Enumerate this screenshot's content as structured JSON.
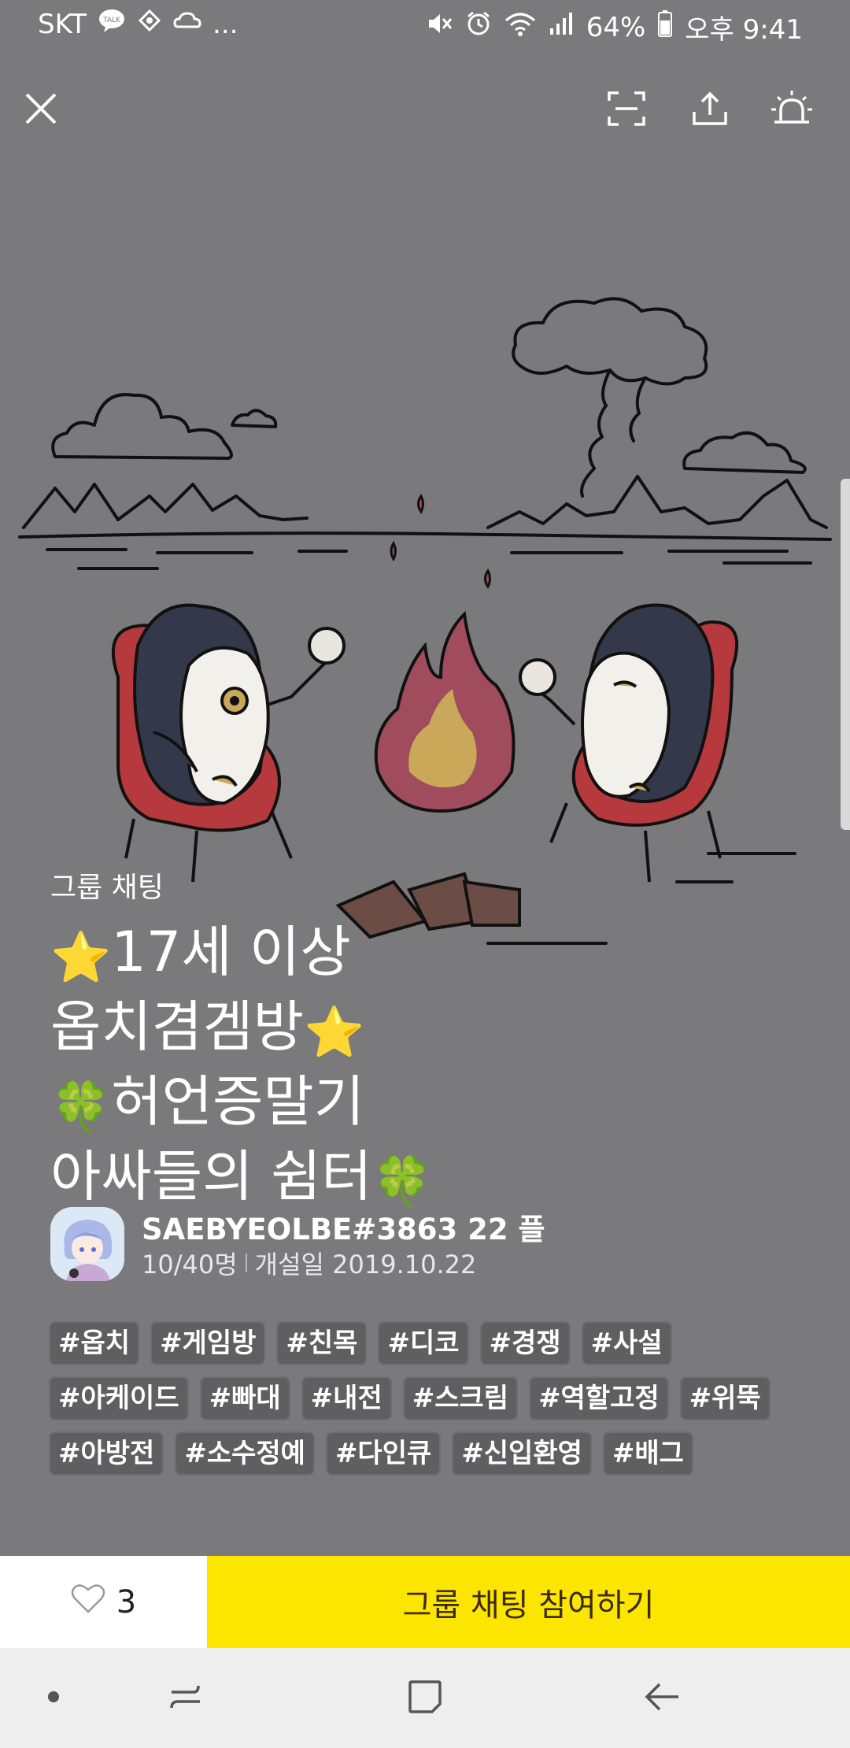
{
  "status_bar": {
    "carrier": "SKT",
    "notif_icons": [
      "talk-icon",
      "app-icon",
      "weather-icon"
    ],
    "more": "...",
    "battery": "64%",
    "time": "오후 9:41"
  },
  "top_bar": {
    "icons": [
      "close-icon",
      "scan-icon",
      "share-icon",
      "report-siren-icon"
    ]
  },
  "room": {
    "category": "그룹 채팅",
    "title_lines": [
      {
        "prefix": "⭐",
        "text": "17세 이상",
        "suffix": ""
      },
      {
        "prefix": "",
        "text": "옵치겸겜방",
        "suffix": "⭐"
      },
      {
        "prefix": "🍀",
        "text": "허언증말기",
        "suffix": ""
      },
      {
        "prefix": "",
        "text": "아싸들의 쉼터",
        "suffix": "🍀"
      }
    ],
    "owner_name": "SAEBYEOLBE#3863 22 플",
    "member_count": "10/40명",
    "opened_label": "개설일 2019.10.22"
  },
  "tags": [
    "#옵치",
    "#게임방",
    "#친목",
    "#디코",
    "#경쟁",
    "#사설",
    "#아케이드",
    "#빠대",
    "#내전",
    "#스크림",
    "#역할고정",
    "#위뚝",
    "#아방전",
    "#소수정예",
    "#다인큐",
    "#신입환영",
    "#배그"
  ],
  "action_bar": {
    "like_count": "3",
    "join_label": "그룹 채팅 참여하기"
  },
  "colors": {
    "background": "#7a797b",
    "join_button": "#fce600",
    "tag_bg": "#5f5e60"
  }
}
